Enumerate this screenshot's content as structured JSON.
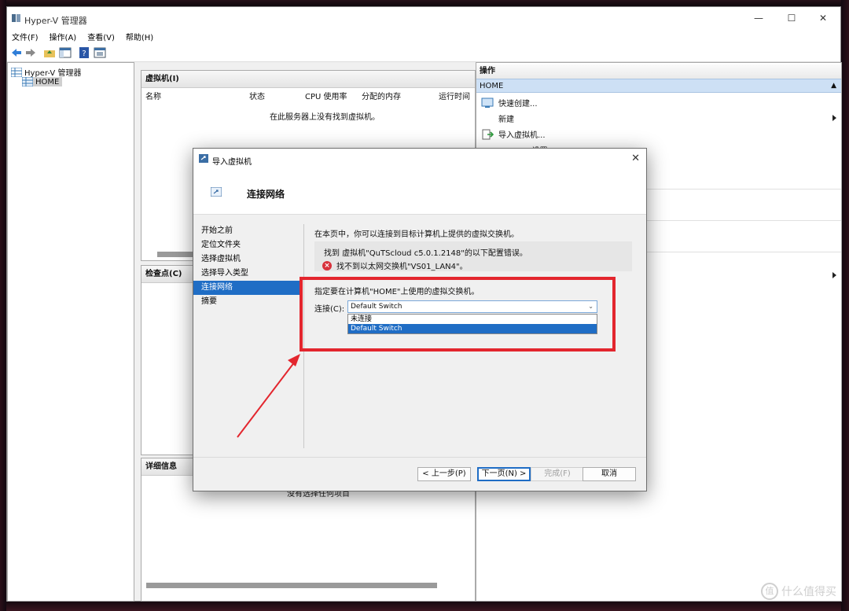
{
  "window": {
    "title": "Hyper-V 管理器",
    "controls": {
      "minimize": "—",
      "maximize": "☐",
      "close": "✕"
    }
  },
  "menu": [
    "文件(F)",
    "操作(A)",
    "查看(V)",
    "帮助(H)"
  ],
  "toolbar": {
    "icons": [
      "back-icon",
      "forward-icon",
      "up-folder-icon",
      "console-tree-icon",
      "help-icon",
      "properties-icon"
    ]
  },
  "tree": {
    "root": "Hyper-V 管理器",
    "server": "HOME"
  },
  "vm_panel": {
    "title": "虚拟机(I)",
    "columns": [
      "名称",
      "状态",
      "CPU 使用率",
      "分配的内存",
      "运行时间"
    ],
    "empty_message": "在此服务器上没有找到虚拟机。"
  },
  "checkpoint_panel": {
    "title": "检查点(C)"
  },
  "details_panel": {
    "title": "详细信息",
    "text": "没有选择任何项目"
  },
  "actions": {
    "header": "操作",
    "section": "HOME",
    "items": [
      "快速创建...",
      "新建",
      "导入虚拟机...",
      "Hyper-V 设置..."
    ]
  },
  "dialog": {
    "title": "导入虚拟机",
    "banner_title": "连接网络",
    "nav": [
      "开始之前",
      "定位文件夹",
      "选择虚拟机",
      "选择导入类型",
      "连接网络",
      "摘要"
    ],
    "active_nav_index": 4,
    "intro": "在本页中，你可以连接到目标计算机上提供的虚拟交换机。",
    "error_line1": "找到 虚拟机\"QuTScloud c5.0.1.2148\"的以下配置错误。",
    "error_line2": "找不到以太网交换机\"VS01_LAN4\"。",
    "prompt": "指定要在计算机\"HOME\"上使用的虚拟交换机。",
    "connect_label": "连接(C):",
    "selected_switch": "Default Switch",
    "switch_options": [
      "未连接",
      "Default Switch"
    ],
    "buttons": {
      "prev": "< 上一步(P)",
      "next": "下一页(N) >",
      "finish": "完成(F)",
      "cancel": "取消"
    }
  },
  "watermark": "什么值得买",
  "colors": {
    "accent": "#1f6dc5",
    "annotation_red": "#e3262e",
    "error_red": "#d8323c",
    "selection": "#cde0f5"
  }
}
